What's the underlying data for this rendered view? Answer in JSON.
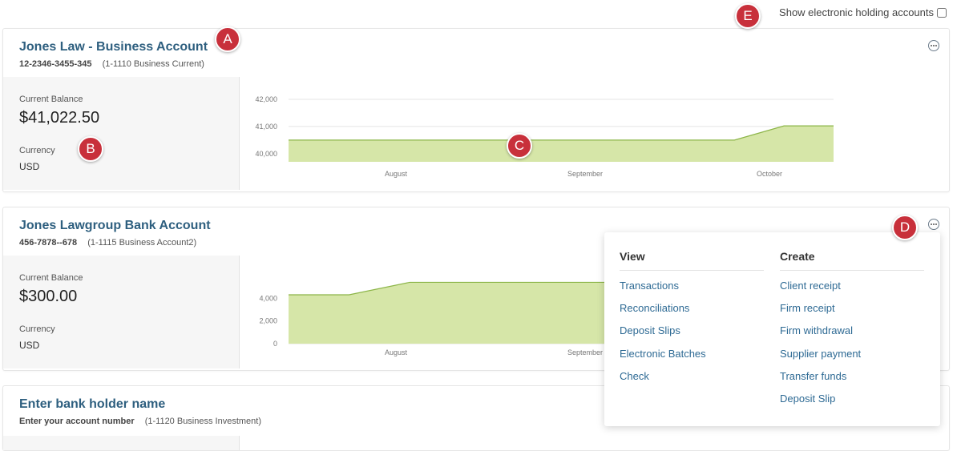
{
  "topbar": {
    "show_electronic_label": "Show electronic holding accounts",
    "checked": false
  },
  "accounts": [
    {
      "title": "Jones Law - Business Account",
      "number": "12-2346-3455-345",
      "ledger": "(1-1110 Business Current)",
      "current_balance_label": "Current Balance",
      "balance": "$41,022.50",
      "currency_label": "Currency",
      "currency": "USD"
    },
    {
      "title": "Jones Lawgroup Bank Account",
      "number": "456-7878--678",
      "ledger": "(1-1115 Business Account2)",
      "current_balance_label": "Current Balance",
      "balance": "$300.00",
      "currency_label": "Currency",
      "currency": "USD"
    },
    {
      "title": "Enter bank holder name",
      "number": "Enter your account number",
      "ledger": "(1-1120 Business Investment)"
    }
  ],
  "chart_data": [
    {
      "type": "area",
      "title": "",
      "xlabel": "",
      "ylabel": "",
      "x_tick_labels": [
        "August",
        "September",
        "October"
      ],
      "y_ticks": [
        40000,
        41000,
        42000
      ],
      "y_tick_labels": [
        "40,000",
        "41,000",
        "42,000"
      ],
      "ylim": [
        39700,
        42000
      ],
      "color": "#d6e6a8",
      "line_color": "#8cb548",
      "series": [
        {
          "values": [
            40500,
            40500,
            40500,
            40500,
            40500,
            40500,
            40500,
            40500,
            40500,
            40500,
            41022.5,
            41022.5
          ]
        }
      ]
    },
    {
      "type": "area",
      "title": "",
      "xlabel": "",
      "ylabel": "",
      "x_tick_labels": [
        "August",
        "September"
      ],
      "y_ticks": [
        0,
        2000,
        4000
      ],
      "y_tick_labels": [
        "0",
        "2,000",
        "4,000"
      ],
      "ylim": [
        0,
        5500
      ],
      "color": "#d6e6a8",
      "line_color": "#8cb548",
      "series": [
        {
          "values": [
            4300,
            4300,
            5400,
            5400,
            5400,
            5400,
            5400,
            5400,
            300,
            300
          ]
        }
      ]
    }
  ],
  "menu": {
    "view_header": "View",
    "create_header": "Create",
    "view_items": [
      "Transactions",
      "Reconciliations",
      "Deposit Slips",
      "Electronic Batches",
      "Check"
    ],
    "create_items": [
      "Client receipt",
      "Firm receipt",
      "Firm withdrawal",
      "Supplier payment",
      "Transfer funds",
      "Deposit Slip"
    ]
  },
  "badges": {
    "a": "A",
    "b": "B",
    "c": "C",
    "d": "D",
    "e": "E"
  },
  "colors": {
    "title": "#2e5f7f",
    "link": "#2e6a94",
    "badge": "#c8303b",
    "area_fill": "#d6e6a8"
  }
}
